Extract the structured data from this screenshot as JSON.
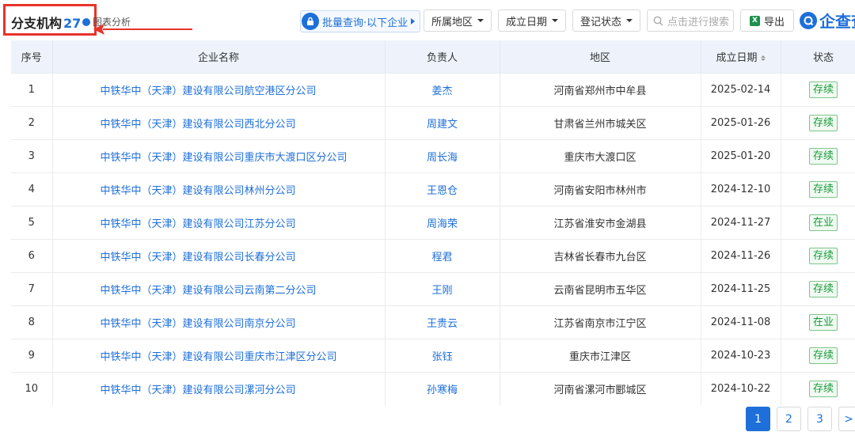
{
  "header": {
    "title": "分支机构",
    "count": "27",
    "chart_link": "图表分析",
    "batch_query": "批量查询·以下企业",
    "filters": [
      "所属地区",
      "成立日期",
      "登记状态"
    ],
    "search_placeholder": "点击进行搜索",
    "export_label": "导出",
    "brand": "企查查"
  },
  "columns": [
    "序号",
    "企业名称",
    "负责人",
    "地区",
    "成立日期",
    "状态"
  ],
  "rows": [
    {
      "no": "1",
      "name": "中铁华中（天津）建设有限公司航空港区分公司",
      "person": "姜杰",
      "region": "河南省郑州市中牟县",
      "date": "2025-02-14",
      "status": "存续"
    },
    {
      "no": "2",
      "name": "中铁华中（天津）建设有限公司西北分公司",
      "person": "周建文",
      "region": "甘肃省兰州市城关区",
      "date": "2025-01-26",
      "status": "存续"
    },
    {
      "no": "3",
      "name": "中铁华中（天津）建设有限公司重庆市大渡口区分公司",
      "person": "周长海",
      "region": "重庆市大渡口区",
      "date": "2025-01-20",
      "status": "存续"
    },
    {
      "no": "4",
      "name": "中铁华中（天津）建设有限公司林州分公司",
      "person": "王恩仓",
      "region": "河南省安阳市林州市",
      "date": "2024-12-10",
      "status": "存续"
    },
    {
      "no": "5",
      "name": "中铁华中（天津）建设有限公司江苏分公司",
      "person": "周海荣",
      "region": "江苏省淮安市金湖县",
      "date": "2024-11-27",
      "status": "在业"
    },
    {
      "no": "6",
      "name": "中铁华中（天津）建设有限公司长春分公司",
      "person": "程君",
      "region": "吉林省长春市九台区",
      "date": "2024-11-26",
      "status": "存续"
    },
    {
      "no": "7",
      "name": "中铁华中（天津）建设有限公司云南第二分公司",
      "person": "王刚",
      "region": "云南省昆明市五华区",
      "date": "2024-11-25",
      "status": "存续"
    },
    {
      "no": "8",
      "name": "中铁华中（天津）建设有限公司南京分公司",
      "person": "王贵云",
      "region": "江苏省南京市江宁区",
      "date": "2024-11-08",
      "status": "在业"
    },
    {
      "no": "9",
      "name": "中铁华中（天津）建设有限公司重庆市江津区分公司",
      "person": "张钰",
      "region": "重庆市江津区",
      "date": "2024-10-23",
      "status": "存续"
    },
    {
      "no": "10",
      "name": "中铁华中（天津）建设有限公司漯河分公司",
      "person": "孙寒梅",
      "region": "河南省漯河市郾城区",
      "date": "2024-10-22",
      "status": "存续"
    }
  ],
  "pagination": {
    "pages": [
      "1",
      "2",
      "3"
    ],
    "next": ">"
  },
  "colors": {
    "accent": "#1e6fd9",
    "highlight_box": "#e8332a",
    "status_green": "#1a9a3b",
    "header_bg": "#eef3fb"
  }
}
